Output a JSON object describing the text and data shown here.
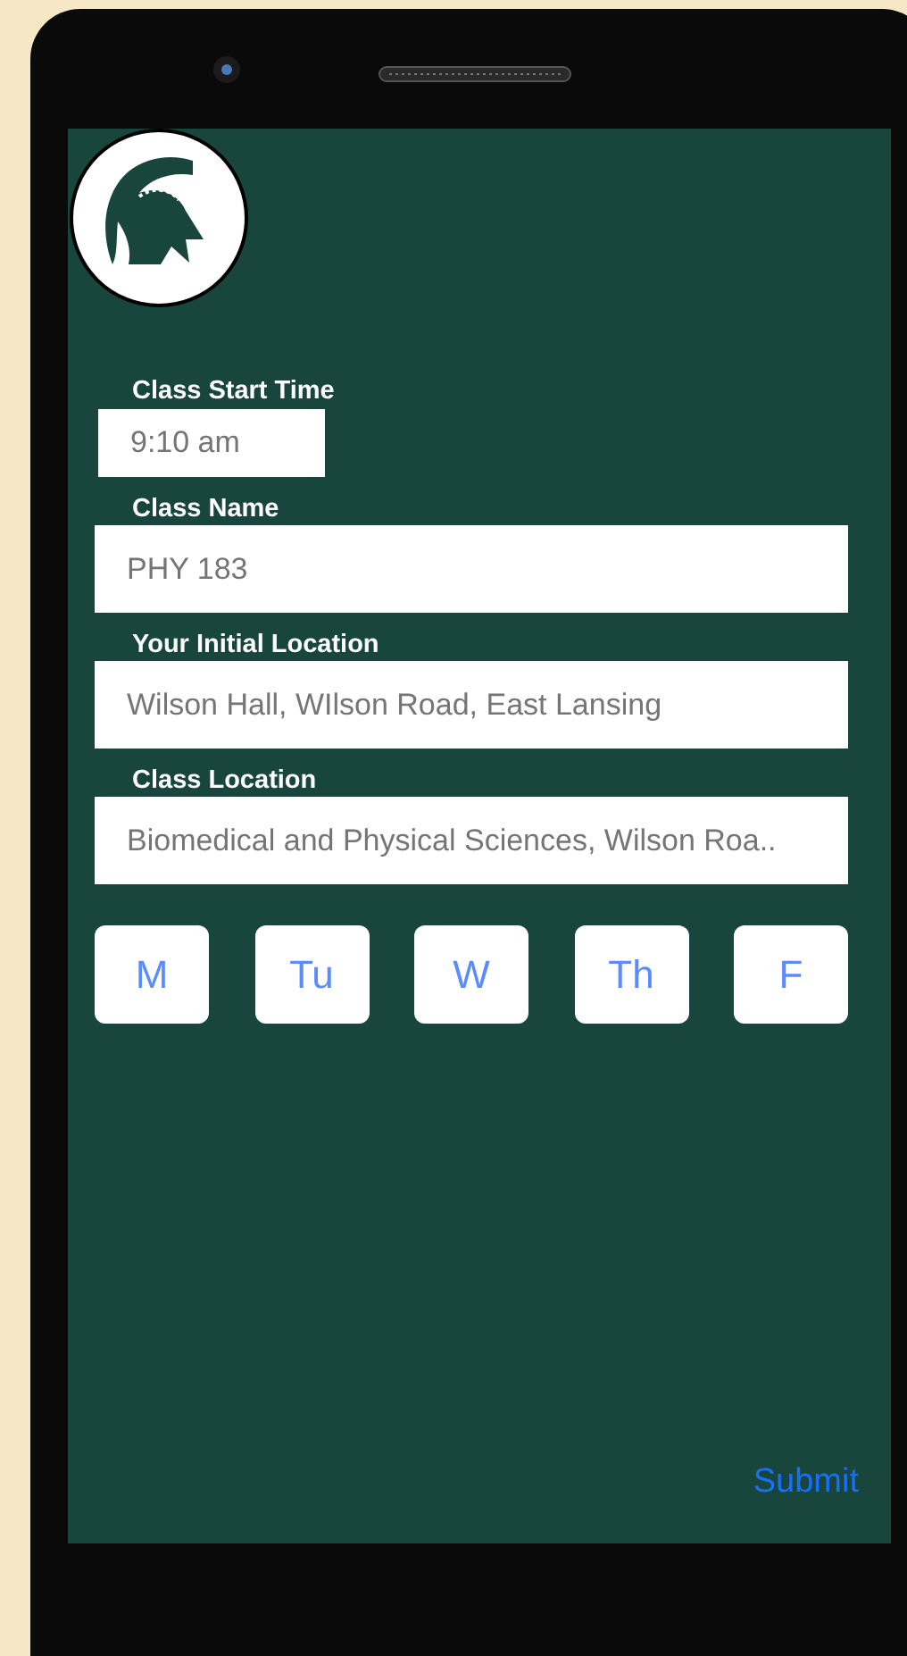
{
  "form": {
    "fields": [
      {
        "kind": "time",
        "label": "Class Start Time",
        "value": "9:10 am"
      },
      {
        "kind": "text",
        "label": "Class Name",
        "value": "PHY 183"
      },
      {
        "kind": "text",
        "label": "Your Initial Location",
        "value": "Wilson Hall, WIlson Road, East Lansing"
      },
      {
        "kind": "text",
        "label": "Class Location",
        "value": "Biomedical and Physical Sciences, Wilson Roa.."
      }
    ],
    "days": [
      "M",
      "Tu",
      "W",
      "Th",
      "F"
    ],
    "submit": "Submit"
  }
}
